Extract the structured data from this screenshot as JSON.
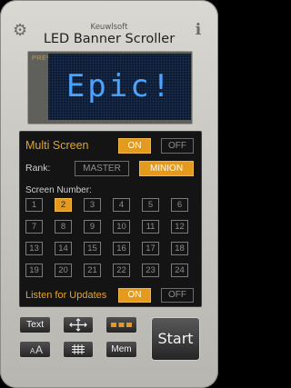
{
  "header": {
    "brand": "Keuwlsoft",
    "title": "LED Banner Scroller",
    "settings_icon": "gear-icon",
    "info_icon": "info-icon",
    "info_glyph": "i"
  },
  "preview": {
    "label": "PREVIEW",
    "text": "Epic!",
    "text_color": "#4aa3ff",
    "background_color": "#0b1930"
  },
  "multi_screen": {
    "label": "Multi Screen",
    "on_label": "ON",
    "off_label": "OFF",
    "selected": "ON"
  },
  "rank": {
    "label": "Rank:",
    "options": [
      "MASTER",
      "MINION"
    ],
    "selected": "MINION"
  },
  "screen_number": {
    "label": "Screen Number:",
    "numbers": [
      "1",
      "2",
      "3",
      "4",
      "5",
      "6",
      "7",
      "8",
      "9",
      "10",
      "11",
      "12",
      "13",
      "14",
      "15",
      "16",
      "17",
      "18",
      "19",
      "20",
      "21",
      "22",
      "23",
      "24"
    ],
    "selected": "2"
  },
  "updates": {
    "label": "Listen for Updates",
    "on_label": "ON",
    "off_label": "OFF",
    "selected": "ON"
  },
  "toolbar": {
    "text_label": "Text",
    "font_size_label_large": "A",
    "font_size_label_small": "A",
    "mem_label": "Mem",
    "start_label": "Start"
  },
  "colors": {
    "accent": "#e39a1e",
    "panel": "#141414",
    "body": "#c9c8c2"
  }
}
